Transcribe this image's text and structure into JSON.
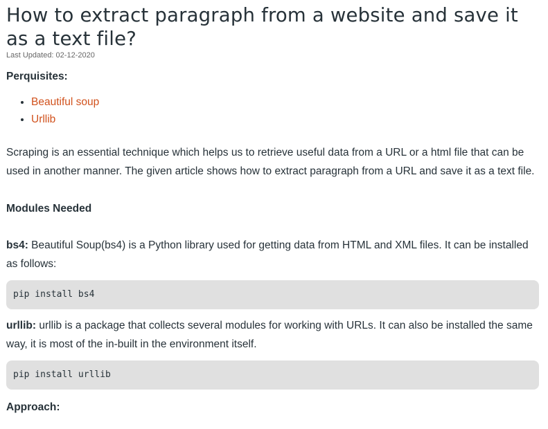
{
  "article": {
    "title": "How to extract paragraph from a website and save it as a text file?",
    "last_updated": "Last Updated: 02-12-2020",
    "prerequisites_heading": "Perquisites:",
    "prerequisites": [
      {
        "label": "Beautiful soup"
      },
      {
        "label": "Urllib"
      }
    ],
    "intro": "Scraping is an essential technique which helps us to retrieve useful data from a URL or a html file that can be used in another manner. The given article shows how to extract paragraph from a URL and save it as a text file.",
    "modules_heading": "Modules Needed",
    "bs4": {
      "term": "bs4:",
      "text": " Beautiful Soup(bs4) is a Python library used for getting data from HTML and XML files. It can be installed as follows:",
      "code": "pip install bs4"
    },
    "urllib": {
      "term": "urllib:",
      "text": " urllib is a package that collects several modules for working with URLs. It can also be installed the same way, it is most of the in-built in the environment itself.",
      "code": "pip install urllib"
    },
    "approach_heading": "Approach:"
  },
  "colors": {
    "text": "#273239",
    "link": "#d1511c",
    "code_background": "#e0e0e0",
    "muted": "#666666"
  }
}
